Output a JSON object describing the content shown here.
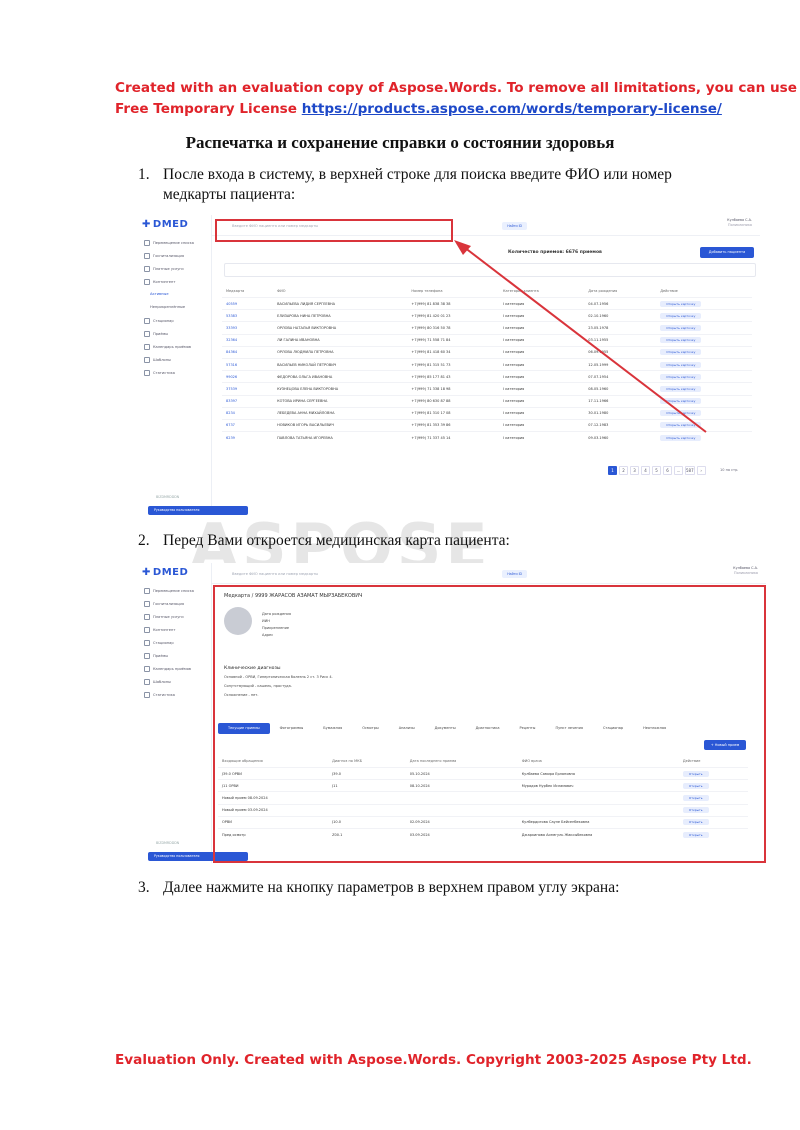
{
  "eval_header": {
    "line1": "Created with an evaluation copy of Aspose.Words. To remove all limitations, you can use",
    "line2_text": "Free Temporary License",
    "line2_link": "https://products.aspose.com/words/temporary-license/"
  },
  "title": "Распечатка и сохранение справки о состоянии здоровья",
  "steps": [
    {
      "num": "1.",
      "text": "После входа в систему, в верхней строке для поиска введите ФИО или номер медкарты пациента:"
    },
    {
      "num": "2.",
      "text": "Перед Вами откроется медицинская карта пациента:"
    },
    {
      "num": "3.",
      "text": "Далее нажмите на кнопку параметров в верхнем правом углу экрана:"
    }
  ],
  "watermark": "ASPOSE",
  "eval_footer": "Evaluation Only. Created with Aspose.Words. Copyright 2003-2025 Aspose Pty Ltd.",
  "colors": {
    "accent": "#2a57d5",
    "alert_red": "#d9343b",
    "eval_red": "#e0232a",
    "link": "#1d48c8"
  },
  "screen1": {
    "logo": "DMED",
    "nav": [
      "Перемещение списка",
      "Госпитализация",
      "Платные услуги",
      "Контингент",
      "Активные",
      "Неприкреплённые",
      "Стационар",
      "Приёмы",
      "Календарь приёмов",
      "Шаблоны",
      "Статистика"
    ],
    "search_placeholder": "Введите ФИО пациента или номер медкарты",
    "search_button": "Найти ID",
    "user": "Кулбаева С.А.",
    "user_sub": "Поликлиника",
    "count_label": "Количество приемов: 6676 приемов",
    "add_button": "Добавить пациента",
    "columns": [
      "Медкарта",
      "ФИО",
      "Номер телефона",
      "Категория клиента",
      "Дата рождения",
      "Действие"
    ],
    "rows": [
      [
        "40559",
        "ВАСИЛЬЕВА ЛИДИЯ СЕРГЕЕВНА",
        "+7(999) 81 838 38 38",
        "I категория",
        "04.07.1956",
        "Открыть карточку"
      ],
      [
        "53383",
        "ЕЛИЗАРОВА НИНА ПЕТРОВНА",
        "+7(999) 81 420 01 23",
        "I категория",
        "02.10.1960",
        "Открыть карточку"
      ],
      [
        "33393",
        "ОРЛОВА НАТАЛЬЯ ВИКТОРОВНА",
        "+7(999) 80 316 50 78",
        "I категория",
        "23.05.1978",
        "Открыть карточку"
      ],
      [
        "32364",
        "ЛИ ГАЛИНА ИВАНОВНА",
        "+7(999) 71 558 71 84",
        "I категория",
        "03.11.1955",
        "Открыть карточку"
      ],
      [
        "84364",
        "ОРЛОВА ЛЮДМИЛА ПЕТРОВНА",
        "+7(999) 81 418 60 34",
        "I категория",
        "06.09.1955",
        "Открыть карточку"
      ],
      [
        "57316",
        "ВАСИЛЬЕВ НИКОЛАЙ ПЕТРОВИЧ",
        "+7(999) 81 315 51 73",
        "I категория",
        "12.05.1999",
        "Открыть карточку"
      ],
      [
        "99026",
        "ФЕДОРОВА ОЛЬГА ИВАНОВНА",
        "+7(999) 85 177 81 43",
        "I категория",
        "07.07.1954",
        "Открыть карточку"
      ],
      [
        "37539",
        "КУЗНЕЦОВА ЕЛЕНА ВИКТОРОВНА",
        "+7(999) 71 338 18 98",
        "I категория",
        "08.05.1960",
        "Открыть карточку"
      ],
      [
        "83397",
        "КОТОВА ИРИНА СЕРГЕЕВНА",
        "+7(999) 80 630 87 88",
        "I категория",
        "17.11.1966",
        "Открыть карточку"
      ],
      [
        "8234",
        "ЛЕБЕДЕВА АННА МИХАЙЛОВНА",
        "+7(999) 81 310 17 08",
        "I категория",
        "30.01.1980",
        "Открыть карточку"
      ],
      [
        "6737",
        "НОВИКОВ ИГОРЬ ВАСИЛЬЕВИЧ",
        "+7(999) 81 353 39 86",
        "I категория",
        "07.12.1983",
        "Открыть карточку"
      ],
      [
        "6239",
        "ПАВЛОВА ТАТЬЯНА ИГОРЕВНА",
        "+7(999) 71 337 45 14",
        "I категория",
        "09.03.1960",
        "Открыть карточку"
      ]
    ],
    "pages": [
      "1",
      "2",
      "3",
      "4",
      "5",
      "6",
      "...",
      "587",
      "›"
    ],
    "page_size": "10 на стр.",
    "workspace": "BIZDMRDDDN",
    "bottom_tile": "Руководство пользователя"
  },
  "screen2": {
    "breadcrumb": "Медкарта / 9999 ЖАРАСОВ АЗАМАТ МЫРЗАБЕКОВИЧ",
    "fields": [
      "Дата рождения",
      "ИИН",
      "Прикрепление",
      "Адрес"
    ],
    "diag_title": "Клинические диагнозы",
    "diag_main": "Основной - ОРВИ, Гипертоническая болезнь 2 ст. 3 Риск 4.",
    "diag_sub": "Сопутствующий - кашель, простуда.",
    "diag_comp": "Осложнение - нет.",
    "tabs": [
      "Текущие приемы",
      "Фотограммы",
      "Бумажная",
      "Осмотры",
      "Анализы",
      "Документы",
      "Диагностика",
      "Рецепты",
      "Пункт лечения",
      "Стационар",
      "Неотложная"
    ],
    "new_visit": "+ Новый прием",
    "columns": [
      "Входящие обращения",
      "Диагноз по МКБ",
      "Дата последнего приема",
      "ФИО врача",
      "Действие"
    ],
    "rows": [
      [
        "J39.0 ОРВИ",
        "J39.0",
        "05.10.2024",
        "Кулбаева Самира Ерлановна",
        "Открыть"
      ],
      [
        "J11 ОРВИ",
        "J11",
        "08.10.2024",
        "Мурадов Нурбек Исламович",
        "Открыть"
      ],
      [
        "Новый прием 08.09.2024",
        "",
        "",
        "",
        "Открыть"
      ],
      [
        "Новый прием 03.09.2024",
        "",
        "",
        "",
        "Открыть"
      ],
      [
        "ОРВИ",
        "J10.0",
        "02.09.2024",
        "Кулбердигова Сауле Бейсенбековна",
        "Открыть"
      ],
      [
        "Пред осмотр",
        "Z00.1",
        "03.09.2024",
        "Джаркинова Асемгуль Жаксыбековна",
        "Открыть"
      ]
    ]
  }
}
